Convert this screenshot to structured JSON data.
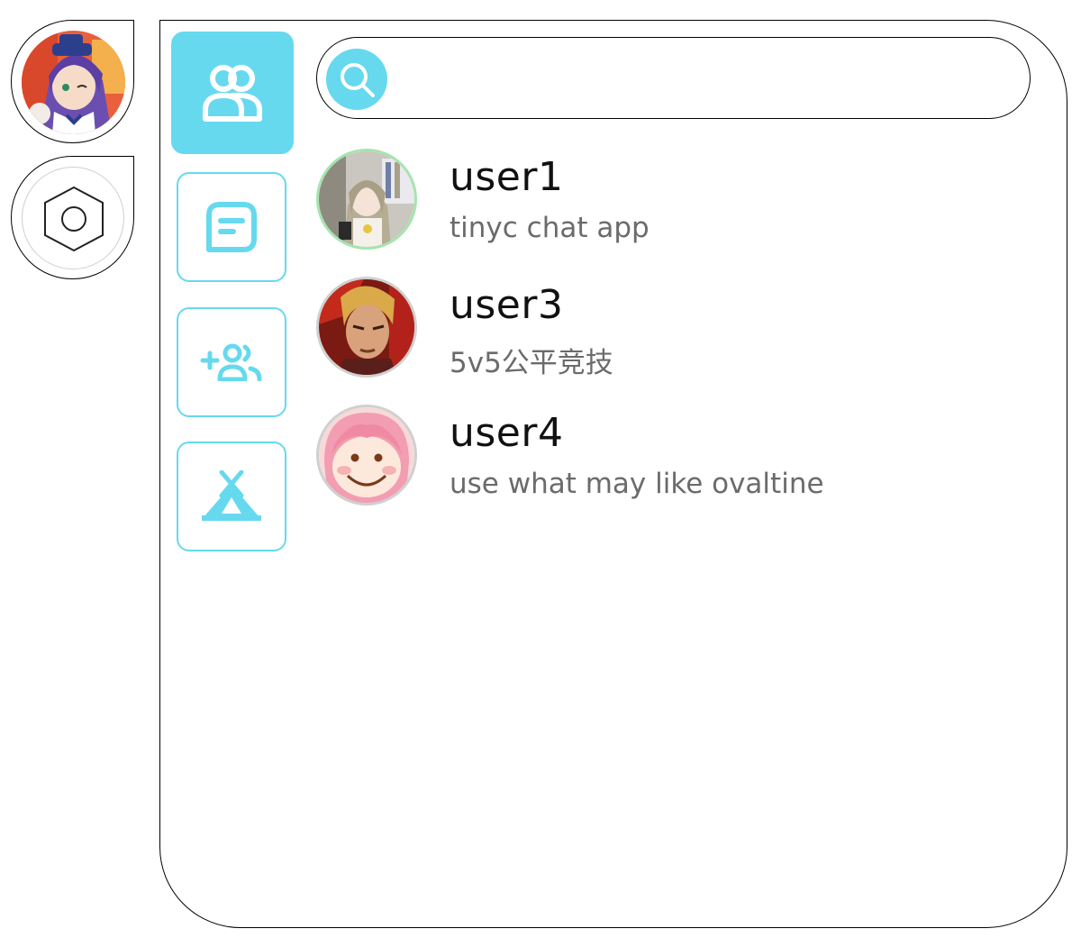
{
  "colors": {
    "accent": "#66d9ef",
    "text": "#111111",
    "muted": "#6b6b6b",
    "border": "#000000"
  },
  "sidebar": {
    "profile_icon": "profile-avatar",
    "settings_icon": "hexagon-gear-icon"
  },
  "nav": [
    {
      "id": "contacts",
      "icon": "contacts-icon",
      "active": true
    },
    {
      "id": "chats",
      "icon": "chat-bubble-icon",
      "active": false
    },
    {
      "id": "add-friend",
      "icon": "add-user-icon",
      "active": false
    },
    {
      "id": "groups",
      "icon": "tent-icon",
      "active": false
    }
  ],
  "search": {
    "icon": "search-icon",
    "placeholder": "",
    "value": ""
  },
  "users": [
    {
      "name": "user1",
      "status": "tinyc chat app",
      "ring": "#a6e4ae"
    },
    {
      "name": "user3",
      "status": "5v5公平竞技",
      "ring": "#d0d0d0"
    },
    {
      "name": "user4",
      "status": "use what may like ovaltine",
      "ring": "#d0d0d0"
    }
  ]
}
